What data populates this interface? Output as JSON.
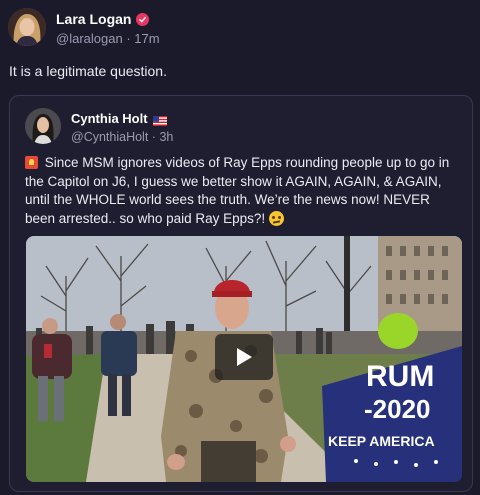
{
  "post": {
    "author_name": "Lara Logan",
    "handle": "@laralogan",
    "separator": "·",
    "time": "17m",
    "text": "It is a legitimate question."
  },
  "quote": {
    "author_name": "Cynthia Holt",
    "handle": "@CynthiaHolt",
    "separator": "·",
    "time": "3h",
    "text": "Since MSM ignores videos of Ray Epps rounding people up to go in the Capitol on J6, I guess we better show it AGAIN, AGAIN, & AGAIN, until the WHOLE world sees the truth. We’re the news now! NEVER been arrested.. so who paid Ray Epps?!",
    "video_sign_line1": "RUM",
    "video_sign_line2": "-2020",
    "video_sign_line3": "KEEP AMERICA"
  },
  "icons": {
    "verified": "verified-badge-icon",
    "flag": "us-flag-icon",
    "siren": "siren-emoji-icon",
    "raised_eyebrow": "raised-eyebrow-emoji-icon",
    "play": "play-icon"
  },
  "colors": {
    "background": "#1b1a2b",
    "verified_badge": "#e8375f",
    "muted_text": "#9c9ab0"
  }
}
